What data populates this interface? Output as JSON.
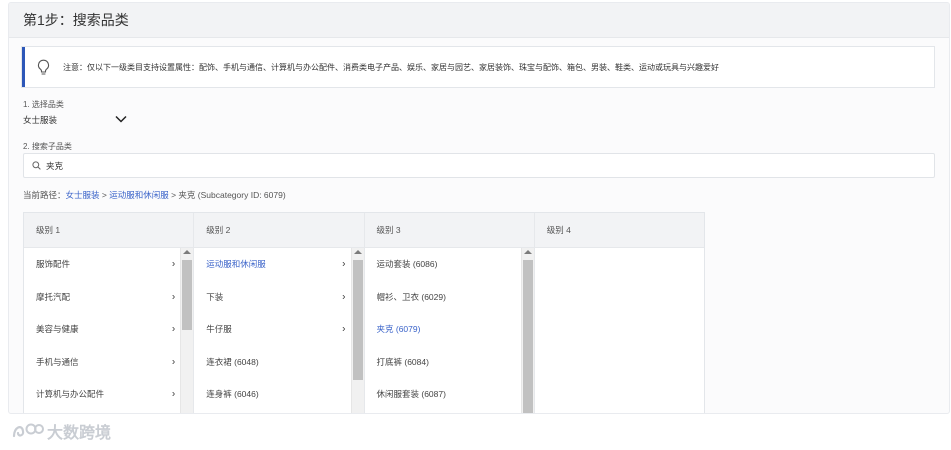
{
  "header": {
    "title": "第1步：搜索品类"
  },
  "notice": {
    "icon": "lightbulb-icon",
    "text": "注意：仅以下一级类目支持设置属性：配饰、手机与通信、计算机与办公配件、消费类电子产品、娱乐、家居与园艺、家居装饰、珠宝与配饰、箱包、男装、鞋类、运动或玩具与兴趣爱好"
  },
  "category_select": {
    "label": "1. 选择品类",
    "value": "女士服装"
  },
  "subcategory_search": {
    "label": "2. 搜索子品类",
    "value": "夹克"
  },
  "path": {
    "prefix": "当前路径：",
    "crumb1": "女士服装",
    "sep1": " > ",
    "crumb2": "运动服和休闲服",
    "sep2": " > ",
    "rest": "夹克 (Subcategory ID: 6079)"
  },
  "columns": [
    {
      "header": "级别 1",
      "items": [
        "服饰配件",
        "摩托汽配",
        "美容与健康",
        "手机与通信",
        "计算机与办公配件"
      ]
    },
    {
      "header": "级别 2",
      "items": [
        "运动服和休闲服",
        "下装",
        "牛仔服",
        "连衣裙 (6048)",
        "连身裤 (6046)"
      ]
    },
    {
      "header": "级别 3",
      "items": [
        "运动套装 (6086)",
        "帽衫、卫衣 (6029)",
        "夹克 (6079)",
        "打底裤 (6084)",
        "休闲服套装 (6087)"
      ]
    },
    {
      "header": "级别 4",
      "items": []
    }
  ],
  "watermark": {
    "text": "大数跨境"
  }
}
